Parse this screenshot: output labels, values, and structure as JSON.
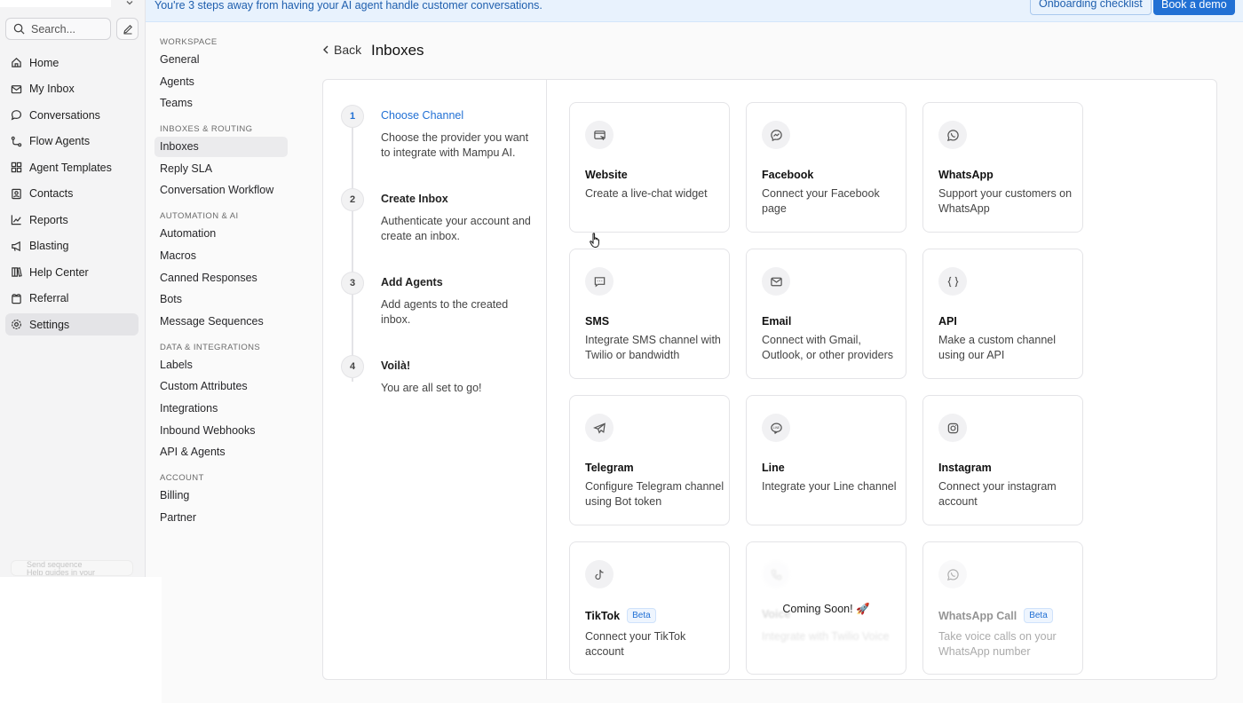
{
  "banner": {
    "text": "You're 3 steps away from having your AI agent handle customer conversations.",
    "checklist_label": "Onboarding checklist",
    "demo_label": "Book a demo",
    "accent": "#2170d4"
  },
  "sidebar": {
    "search_placeholder": "Search...",
    "items": [
      {
        "label": "Home",
        "icon": "home-icon"
      },
      {
        "label": "My Inbox",
        "icon": "inbox-icon"
      },
      {
        "label": "Conversations",
        "icon": "chat-icon"
      },
      {
        "label": "Flow Agents",
        "icon": "flow-icon"
      },
      {
        "label": "Agent Templates",
        "icon": "grid-icon"
      },
      {
        "label": "Contacts",
        "icon": "contacts-icon"
      },
      {
        "label": "Reports",
        "icon": "chart-icon"
      },
      {
        "label": "Blasting",
        "icon": "megaphone-icon"
      },
      {
        "label": "Help Center",
        "icon": "book-icon"
      },
      {
        "label": "Referral",
        "icon": "gift-icon"
      },
      {
        "label": "Settings",
        "icon": "gear-icon",
        "active": true
      }
    ],
    "footer_line1": "Send sequence",
    "footer_line2": "Help guides in your"
  },
  "settings_menu": {
    "groups": [
      {
        "title": "WORKSPACE",
        "items": [
          "General",
          "Agents",
          "Teams"
        ]
      },
      {
        "title": "INBOXES & ROUTING",
        "items": [
          "Inboxes",
          "Reply SLA",
          "Conversation Workflow"
        ]
      },
      {
        "title": "AUTOMATION & AI",
        "items": [
          "Automation",
          "Macros",
          "Canned Responses",
          "Bots",
          "Message Sequences"
        ]
      },
      {
        "title": "DATA & INTEGRATIONS",
        "items": [
          "Labels",
          "Custom Attributes",
          "Integrations",
          "Inbound Webhooks",
          "API & Agents"
        ]
      },
      {
        "title": "ACCOUNT",
        "items": [
          "Billing",
          "Partner"
        ]
      }
    ],
    "active": "Inboxes"
  },
  "header": {
    "back_label": "Back",
    "title": "Inboxes"
  },
  "steps": [
    {
      "num": "1",
      "title": "Choose Channel",
      "desc": "Choose the provider you want to integrate with Mampu AI.",
      "active": true
    },
    {
      "num": "2",
      "title": "Create Inbox",
      "desc": "Authenticate your account and create an inbox."
    },
    {
      "num": "3",
      "title": "Add Agents",
      "desc": "Add agents to the created inbox."
    },
    {
      "num": "4",
      "title": "Voilà!",
      "desc": "You are all set to go!"
    }
  ],
  "channels": [
    {
      "name": "Website",
      "desc": "Create a live-chat widget",
      "icon": "website-icon"
    },
    {
      "name": "Facebook",
      "desc": "Connect your Facebook page",
      "icon": "messenger-icon"
    },
    {
      "name": "WhatsApp",
      "desc": "Support your customers on WhatsApp",
      "icon": "whatsapp-icon"
    },
    {
      "name": "SMS",
      "desc": "Integrate SMS channel with Twilio or bandwidth",
      "icon": "sms-icon"
    },
    {
      "name": "Email",
      "desc": "Connect with Gmail, Outlook, or other providers",
      "icon": "email-icon"
    },
    {
      "name": "API",
      "desc": "Make a custom channel using our API",
      "icon": "api-icon"
    },
    {
      "name": "Telegram",
      "desc": "Configure Telegram channel using Bot token",
      "icon": "telegram-icon"
    },
    {
      "name": "Line",
      "desc": "Integrate your Line channel",
      "icon": "line-icon"
    },
    {
      "name": "Instagram",
      "desc": "Connect your instagram account",
      "icon": "instagram-icon"
    },
    {
      "name": "TikTok",
      "desc": "Connect your TikTok account",
      "icon": "tiktok-icon",
      "badge": "Beta"
    },
    {
      "name": "Voice",
      "desc": "Integrate with Twilio Voice",
      "icon": "phone-icon",
      "overlay": "Coming Soon! 🚀"
    },
    {
      "name": "WhatsApp Call",
      "desc": "Take voice calls on your WhatsApp number",
      "icon": "whatsapp-icon",
      "badge": "Beta"
    }
  ]
}
